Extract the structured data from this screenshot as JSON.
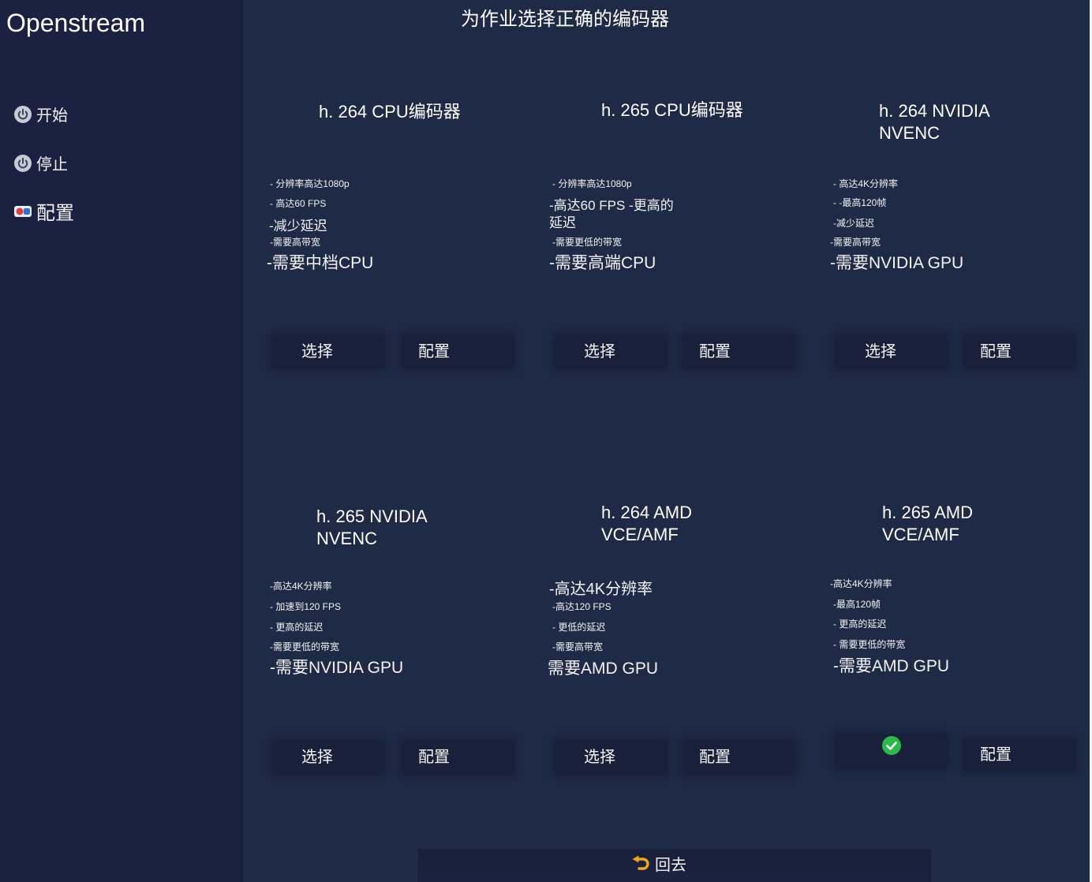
{
  "app": {
    "title": "Openstream"
  },
  "sidebar": {
    "items": [
      {
        "label": "开始",
        "icon": "power-icon"
      },
      {
        "label": "停止",
        "icon": "power-icon"
      },
      {
        "label": "配置",
        "icon": "config-icon"
      }
    ]
  },
  "main": {
    "title": "为作业选择正确的编码器"
  },
  "encoders": [
    {
      "title": [
        "h. 264 CPU编码器"
      ],
      "features": [
        "- 分辨率高达1080p",
        "- 高达60 FPS",
        "-减少延迟",
        "-需要高带宽",
        "-需要中档CPU"
      ],
      "select_label": "选择",
      "config_label": "配置",
      "selected": false
    },
    {
      "title": [
        "h. 265 CPU编码器"
      ],
      "features": [
        "- 分辨率高达1080p",
        "-高达60 FPS -更高的延迟",
        "-需要更低的带宽",
        "-需要高端CPU"
      ],
      "select_label": "选择",
      "config_label": "配置",
      "selected": false
    },
    {
      "title": [
        "h. 264 NVIDIA",
        "NVENC"
      ],
      "features": [
        "- 高达4K分辨率",
        "- -最高120帧",
        "-减少延迟",
        "-需要高带宽",
        "-需要NVIDIA GPU"
      ],
      "select_label": "选择",
      "config_label": "配置",
      "selected": false
    },
    {
      "title": [
        "h. 265 NVIDIA",
        "NVENC"
      ],
      "features": [
        "-高达4K分辨率",
        "- 加速到120 FPS",
        "- 更高的延迟",
        "-需要更低的带宽",
        "-需要NVIDIA GPU"
      ],
      "select_label": "选择",
      "config_label": "配置",
      "selected": false
    },
    {
      "title": [
        "h. 264 AMD",
        "VCE/AMF"
      ],
      "features": [
        "-高达4K分辨率",
        "-高达120 FPS",
        "- 更低的延迟",
        "-需要高带宽",
        "需要AMD GPU"
      ],
      "select_label": "选择",
      "config_label": "配置",
      "selected": false
    },
    {
      "title": [
        "h. 265 AMD",
        "VCE/AMF"
      ],
      "features": [
        "-高达4K分辨率",
        "-最高120帧",
        "- 更高的延迟",
        "- 需要更低的带宽",
        "-需要AMD GPU"
      ],
      "selected_icon": "check-circle-icon",
      "config_label": "配置",
      "selected": true
    }
  ],
  "footer": {
    "back_label": "回去",
    "back_icon": "return-arrow-icon"
  },
  "colors": {
    "sidebar_bg": "#1b2241",
    "main_bg": "#1f2a46",
    "button_bg": "#19203a",
    "selected": "#2db84a",
    "back_icon": "#f2a51a"
  }
}
